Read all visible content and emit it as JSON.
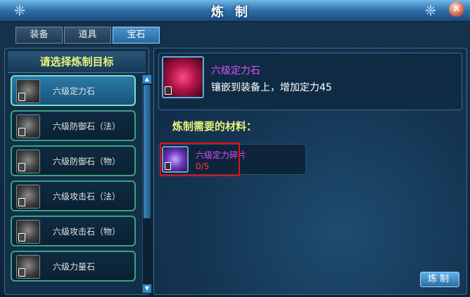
{
  "window": {
    "title": "炼制",
    "close_symbol": "✕"
  },
  "tabs": [
    {
      "label": "装备",
      "active": false
    },
    {
      "label": "道具",
      "active": false
    },
    {
      "label": "宝石",
      "active": true
    }
  ],
  "left": {
    "header": "请选择炼制目标",
    "items": [
      {
        "label": "六级定力石",
        "selected": true,
        "icon": "stone-icon"
      },
      {
        "label": "六级防御石（法）",
        "selected": false,
        "icon": "stone-icon"
      },
      {
        "label": "六级防御石（物）",
        "selected": false,
        "icon": "stone-icon"
      },
      {
        "label": "六级攻击石（法）",
        "selected": false,
        "icon": "stone-icon"
      },
      {
        "label": "六级攻击石（物）",
        "selected": false,
        "icon": "stone-icon"
      },
      {
        "label": "六级力量石",
        "selected": false,
        "icon": "stone-icon"
      }
    ]
  },
  "detail": {
    "name": "六级定力石",
    "description": "镶嵌到装备上，增加定力45",
    "requirement_title": "炼制需要的材料：",
    "material": {
      "name": "六级定力碎片",
      "count": "0/5"
    }
  },
  "actions": {
    "smelt_label": "炼制"
  },
  "colors": {
    "accent": "#e8f27a",
    "item_name": "#e04dff",
    "warning": "#ff3a3a"
  }
}
